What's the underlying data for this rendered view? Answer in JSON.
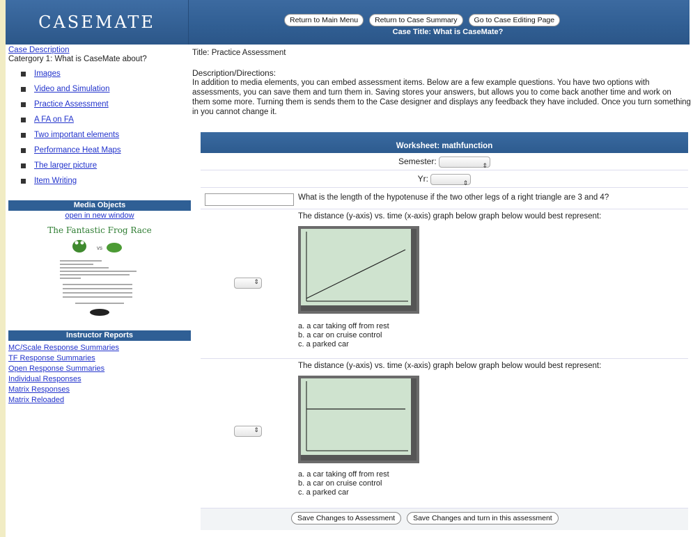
{
  "header": {
    "logo": "CASEMATE",
    "buttons": [
      "Return to Main Menu",
      "Return to Case Summary",
      "Go to Case Editing Page"
    ],
    "case_title": "Case Title: What is CaseMate?"
  },
  "sidebar": {
    "case_description": "Case Description",
    "category": "Catergory 1: What is CaseMate about?",
    "items": [
      {
        "label": "Images"
      },
      {
        "label": "Video and Simulation"
      },
      {
        "label": "Practice Assessment"
      },
      {
        "label": "A FA on FA"
      },
      {
        "label": "Two important elements"
      },
      {
        "label": "Performance Heat Maps"
      },
      {
        "label": "The larger picture"
      },
      {
        "label": "Item Writing"
      }
    ],
    "media_title": "Media Objects",
    "open_new_window": "open in new window",
    "media_thumb_title": "The Fantastic Frog Race",
    "media_vs": "vs",
    "reports_title": "Instructor Reports",
    "reports": [
      "MC/Scale Response Summaries",
      "TF Response Summaries",
      "Open Response Summaries",
      "Individual Responses",
      "Matrix Responses",
      "Matrix Reloaded"
    ]
  },
  "main": {
    "title": "Title: Practice Assessment",
    "desc_label": "Description/Directions:",
    "description": "In addition to media elements, you can embed assessment items. Below are a few example questions. You have two options with assessments, you can save them and turn them in. Saving stores your answers, but allows you to come back another time and work on them some more. Turning them is sends them to the Case designer and displays any feedback they have included. Once you turn something in you cannot change it.",
    "worksheet_title": "Worksheet: mathfunction",
    "semester_label": "Semester:",
    "yr_label": "Yr:",
    "q1": "What is the length of the hypotenuse if the two other legs of a right triangle are 3 and 4?",
    "q2": "The distance (y-axis) vs. time (x-axis) graph below graph below would best represent:",
    "q3": "The distance (y-axis) vs. time (x-axis) graph below graph below would best represent:",
    "choices": [
      "a. a car taking off from rest",
      "b. a car on cruise control",
      "c. a parked car"
    ],
    "save_btn": "Save Changes to Assessment",
    "turn_in_btn": "Save Changes and turn in this assessment"
  },
  "colors": {
    "header_blue": "#315f94",
    "link": "#2233cc",
    "graph_bg": "#cfe3cf"
  }
}
